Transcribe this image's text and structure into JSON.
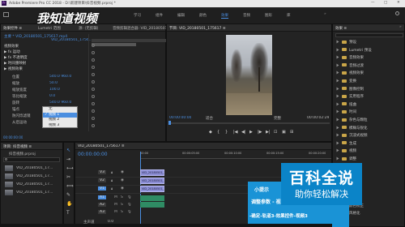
{
  "window": {
    "title": "Adobe Premiere Pro CC 2018 - D:\\新建项目\\抖音视频.prproj *",
    "controls": [
      "—",
      "□",
      "✕"
    ]
  },
  "workspace_tabs": [
    "学习",
    "组件",
    "编辑",
    "颜色",
    "效果",
    "音频",
    "图形",
    "库"
  ],
  "workspace_active": 4,
  "watermark_logo": "我知道视频",
  "effect_controls": {
    "tabs": [
      "效果控件 ≡",
      "Lumetri 范围",
      "源: (无剪辑)",
      "音频剪辑混合器: VID_20180501_..."
    ],
    "source_line": "主要 * VID_20180501_175617.mp4",
    "sequence_line": "VID_20180501_1756...",
    "sections": [
      "视频效果",
      "▶ fx 运动",
      "▶ fx 不透明度",
      "▶ 时间重映射",
      "▶ 视频效果"
    ],
    "params": [
      "位置",
      "缩放",
      "缩放宽度",
      "等比缩放",
      "旋转",
      "锚点",
      "防闪烁滤镜",
      "从后运动"
    ],
    "values": [
      "540.0  960.0",
      "50.0",
      "100.0",
      "0.0",
      "540.0  960.0",
      "0.00"
    ],
    "timecode": "00:00:00:00"
  },
  "dropdown": {
    "items": [
      "无",
      "视频 1",
      "视频 2",
      "视频 3"
    ],
    "selected": 1
  },
  "program_monitor": {
    "tab": "节目: VID_20180501_175617 ≡",
    "tc_left": "00:00:00:00",
    "fit": "适合",
    "quality": "完整",
    "tc_right": "00:00:02:29"
  },
  "effects_panel": {
    "tab": "效果 ≡",
    "items": [
      "预设",
      "Lumetri 预设",
      "音频效果",
      "音频过渡",
      "视频效果",
      "变换",
      "图像控制",
      "实用程序",
      "扭曲",
      "时间",
      "杂色与颗粒",
      "模糊与锐化",
      "沉浸式视频",
      "生成",
      "视频",
      "调整",
      "过时",
      "过渡",
      "透视",
      "通道",
      "键控",
      "颜色校正",
      "风格化"
    ]
  },
  "project_panel": {
    "tab": "项目: 抖音视频 ≡",
    "path": "抖音视频.prproj",
    "search": "",
    "items": [
      "VID_20180501_17...",
      "VID_20180501_17...",
      "VID_20180501_17...",
      "VID_20180501_17..."
    ]
  },
  "timeline": {
    "tab": "VID_20180501_175617 ≡",
    "timecode": "00:00:00:00",
    "ruler": [
      "00:00",
      "00:00:05:00",
      "00:00:10:00",
      "00:00:15:00",
      "00:00:20:00"
    ],
    "video_tracks": [
      "V3",
      "V2",
      "V1"
    ],
    "audio_tracks": [
      "A1",
      "A2",
      "A3"
    ],
    "master": "主声道",
    "master_value": "0.0",
    "clips": [
      "VID_20180501_1756",
      "VID_20180501_1756",
      "VID_20180501_1756"
    ]
  },
  "tip_box": {
    "lines": [
      "小提示",
      "调整参数 - 视",
      "-确定-轨道3-效果控件-视频3"
    ]
  },
  "baike": {
    "logo": "百科全说",
    "slogan": "助你轻松解决"
  },
  "colors": {
    "accent": "#4a8ee0",
    "clip": "#8d8fd6",
    "tip_bg": "#1a93d6",
    "baike_bg": "#0b84c8"
  }
}
